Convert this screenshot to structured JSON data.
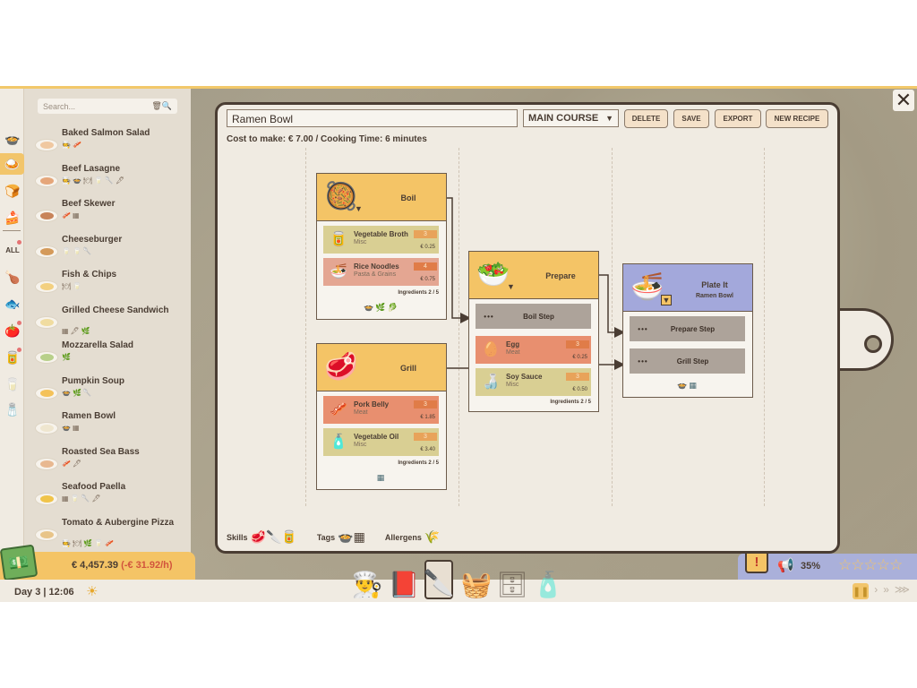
{
  "search": {
    "placeholder": "Search..."
  },
  "categories": [
    {
      "name": "soup-category-icon",
      "glyph": "🍲"
    },
    {
      "name": "main-course-category-icon",
      "glyph": "🍛",
      "active": true
    },
    {
      "name": "bread-category-icon",
      "glyph": "🍞"
    },
    {
      "name": "dessert-category-icon",
      "glyph": "🍰"
    },
    {
      "name": "all-category",
      "glyph": "ALL",
      "badge": true
    },
    {
      "name": "meat-filter-icon",
      "glyph": "🍗"
    },
    {
      "name": "fish-filter-icon",
      "glyph": "🐟"
    },
    {
      "name": "vegetable-filter-icon",
      "glyph": "🍅",
      "badge": true
    },
    {
      "name": "pantry-filter-icon",
      "glyph": "🥫",
      "badge": true
    },
    {
      "name": "dairy-filter-icon",
      "glyph": "🥛"
    },
    {
      "name": "sauce-filter-icon",
      "glyph": "🧂"
    }
  ],
  "recipes": [
    {
      "name": "Baked Salmon Salad",
      "tags": "🧑‍🍳🥓",
      "color": "#f0c8a0"
    },
    {
      "name": "Beef Lasagne",
      "tags": "🧑‍🍳🍲🍽🥛🥄🖋",
      "color": "#e5a67a"
    },
    {
      "name": "Beef Skewer",
      "tags": "🥓▦",
      "color": "#c8845a"
    },
    {
      "name": "Cheeseburger",
      "tags": "🥛🥛🥄",
      "color": "#d49a5a"
    },
    {
      "name": "Fish & Chips",
      "tags": "🍽🥛",
      "color": "#f3d080"
    },
    {
      "name": "Grilled Cheese Sandwich",
      "tags": "▦🖋🌿",
      "color": "#f0dca0"
    },
    {
      "name": "Mozzarella Salad",
      "tags": "🌿",
      "color": "#b8d08a"
    },
    {
      "name": "Pumpkin Soup",
      "tags": "🍲🌿🥄",
      "color": "#f4c25a"
    },
    {
      "name": "Ramen Bowl",
      "tags": "🍲▦",
      "color": "#efe6cf"
    },
    {
      "name": "Roasted Sea Bass",
      "tags": "🥓🖋",
      "color": "#e8b890"
    },
    {
      "name": "Seafood Paella",
      "tags": "▦🥛🥄🖋",
      "color": "#f0c44a"
    },
    {
      "name": "Tomato & Aubergine Pizza",
      "tags": "🧑‍🍳🍽🌿🥛🥓",
      "color": "#e8c488"
    }
  ],
  "money": {
    "balance": "€ 4,457.39",
    "rate": "(-€ 31.92/h)"
  },
  "time": {
    "day": "Day 3 | 12:06"
  },
  "status": {
    "hype": "35%",
    "stars": "☆☆☆☆☆",
    "alert": "!"
  },
  "toolbar": {
    "recipe_name": "Ramen Bowl",
    "course": "MAIN COURSE",
    "delete": "DELETE",
    "save": "SAVE",
    "export": "EXPORT",
    "new_recipe": "NEW RECIPE"
  },
  "summary": {
    "cost_line": "Cost to make: € 7.00 / Cooking Time: 6 minutes"
  },
  "steps": {
    "boil": {
      "title": "Boil",
      "ingredients": [
        {
          "name": "Vegetable Broth",
          "category": "Misc",
          "qty": "3",
          "price": "€ 0.25"
        },
        {
          "name": "Rice Noodles",
          "category": "Pasta & Grains",
          "qty": "4",
          "price": "€ 0.75"
        }
      ],
      "count": "Ingredients  2 / 5"
    },
    "grill": {
      "title": "Grill",
      "ingredients": [
        {
          "name": "Pork Belly",
          "category": "Meat",
          "qty": "3",
          "price": "€ 1.85"
        },
        {
          "name": "Vegetable Oil",
          "category": "Misc",
          "qty": "3",
          "price": "€ 3.40"
        }
      ],
      "count": "Ingredients  2 / 5"
    },
    "prepare": {
      "title": "Prepare",
      "slot": "Boil Step",
      "ingredients": [
        {
          "name": "Egg",
          "category": "Meat",
          "qty": "3",
          "price": "€ 0.25"
        },
        {
          "name": "Soy Sauce",
          "category": "Misc",
          "qty": "3",
          "price": "€ 0.50"
        }
      ],
      "count": "Ingredients  2 / 5"
    },
    "plate": {
      "title": "Plate It",
      "subtitle": "Ramen Bowl",
      "slots": [
        "Prepare Step",
        "Grill Step"
      ]
    }
  },
  "footer": {
    "skills": "Skills",
    "tags": "Tags",
    "allergens": "Allergens"
  },
  "colors": {
    "accent": "#f4c466",
    "board": "#f0ebe2",
    "outline": "#4a3d33",
    "plate_head": "#a3a8db"
  }
}
